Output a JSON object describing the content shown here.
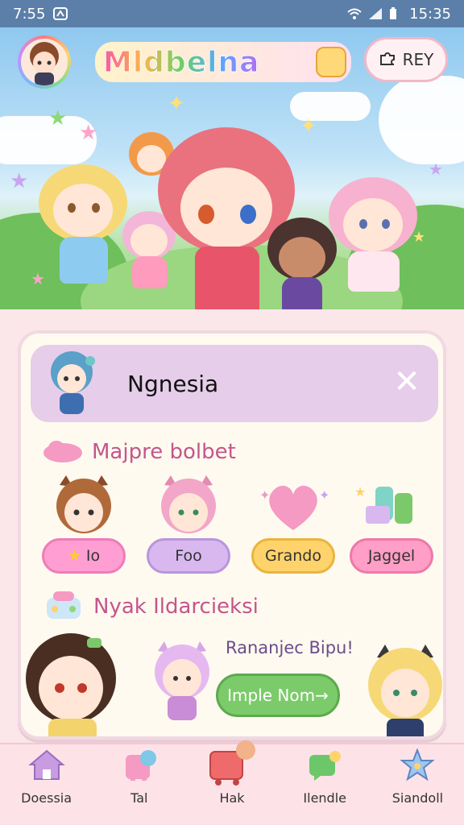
{
  "status_bar": {
    "time_left": "7:55",
    "time_right": "15:35",
    "left_icon": "screenshot-icon",
    "right_icons": [
      "wifi-icon",
      "signal-icon",
      "battery-icon"
    ]
  },
  "header": {
    "logo_text": "Mldbelna",
    "rey_button_label": "REY",
    "rey_button_icon": "puzzle-icon"
  },
  "search": {
    "value": "Ngnesia",
    "close_icon": "close-icon"
  },
  "sections": {
    "first_title": "Majpre bolbet",
    "second_title": "Nyak Ildarcieksi"
  },
  "categories": [
    {
      "label": "Io",
      "color": "#ff9ed2",
      "border": "#f07bb9"
    },
    {
      "label": "Foo",
      "color": "#d9b8f0",
      "border": "#b995db"
    },
    {
      "label": "Grando",
      "color": "#ffd36b",
      "border": "#e9b43d"
    },
    {
      "label": "Jaggel",
      "color": "#ff9ec6",
      "border": "#ee78a9"
    }
  ],
  "promo": {
    "text": "Rananjec Bipu!",
    "cta_label": "Imple Nom→"
  },
  "nav": [
    {
      "label": "Doessia",
      "icon": "home-icon"
    },
    {
      "label": "Tal",
      "icon": "pet-icon"
    },
    {
      "label": "Hak",
      "icon": "cart-icon"
    },
    {
      "label": "Ilendle",
      "icon": "chat-icon"
    },
    {
      "label": "Siandoll",
      "icon": "star-icon"
    }
  ],
  "colors": {
    "status_bar": "#5b7fa8",
    "accent_pink": "#c4568c",
    "cta_green": "#7ccb6a"
  }
}
